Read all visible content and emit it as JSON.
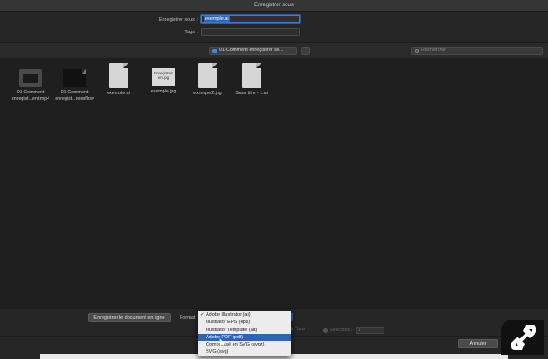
{
  "window": {
    "title": "Enregistrer sous"
  },
  "form": {
    "save_as_label": "Enregistrer sous :",
    "save_as_value": "exemple.ai",
    "tags_label": "Tags :",
    "tags_value": ""
  },
  "toolbar": {
    "location": "01-Comment enregistrer so...",
    "search_placeholder": "Rechercher"
  },
  "files": [
    {
      "name": "01-Comment enregist...ent.mp4",
      "line1": "01-Comment",
      "line2": "enregist...ent.mp4",
      "kind": "video"
    },
    {
      "name": "01-Comment enregist...reenflow",
      "line1": "01-Comment",
      "line2": "enregist...reenflow",
      "kind": "dark"
    },
    {
      "name": "exemple.ai",
      "line1": "exemple.ai",
      "line2": "",
      "kind": "doc"
    },
    {
      "name": "exemple.jpg",
      "line1": "exemple.jpg",
      "line2": "",
      "kind": "jpg",
      "thumb_text": "Enregistrer en.jpg"
    },
    {
      "name": "exemple2.jpg",
      "line1": "exemple2.jpg",
      "line2": "",
      "kind": "doc"
    },
    {
      "name": "Sans titre - 1.ai",
      "line1": "Sans titre - 1.ai",
      "line2": "",
      "kind": "doc"
    }
  ],
  "bottom": {
    "online_button": "Enregistrer le document en ligne",
    "format_label": "Format",
    "all_label": "Tous",
    "selection_label": "Sélection :",
    "selection_value": "1",
    "cancel_button": "Annuler"
  },
  "format_menu": {
    "items": [
      "Adobe Illustrator (ai)",
      "Illustrator EPS (eps)",
      "Illustrator Template (ait)",
      "Adobe PDF (pdf)",
      "Compressé en SVG (svgz)",
      "SVG (svg)"
    ],
    "checked": "Adobe Illustrator (ai)",
    "highlighted": "Adobe PDF (pdf)"
  },
  "colors": {
    "accent": "#2f64b1",
    "background": "#262626",
    "menu_bg": "#ececec"
  },
  "watermark": {
    "icon": "link-logo-icon"
  }
}
